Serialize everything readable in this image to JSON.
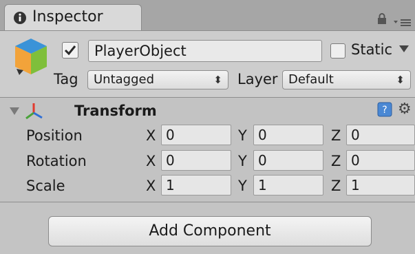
{
  "tab": {
    "label": "Inspector"
  },
  "object": {
    "name": "PlayerObject",
    "active": true,
    "static_label": "Static",
    "static": false,
    "tag_label": "Tag",
    "tag_value": "Untagged",
    "layer_label": "Layer",
    "layer_value": "Default"
  },
  "transform": {
    "title": "Transform",
    "rows": [
      {
        "label": "Position",
        "x": "0",
        "y": "0",
        "z": "0"
      },
      {
        "label": "Rotation",
        "x": "0",
        "y": "0",
        "z": "0"
      },
      {
        "label": "Scale",
        "x": "1",
        "y": "1",
        "z": "1"
      }
    ],
    "axis_labels": {
      "x": "X",
      "y": "Y",
      "z": "Z"
    }
  },
  "add_component_label": "Add Component",
  "icons": {
    "tab": "info-icon",
    "lock": "lock-icon",
    "menu": "menu-icon",
    "object": "cube-icon",
    "transform": "axes-icon",
    "help": "help-icon",
    "settings": "gear-icon"
  },
  "colors": {
    "cube_top": "#3a93d8",
    "cube_left": "#f2a33a",
    "cube_right": "#7fbf3b",
    "axis_red": "#e23a2e",
    "axis_green": "#4aa33a",
    "axis_blue": "#2f6fd6"
  }
}
